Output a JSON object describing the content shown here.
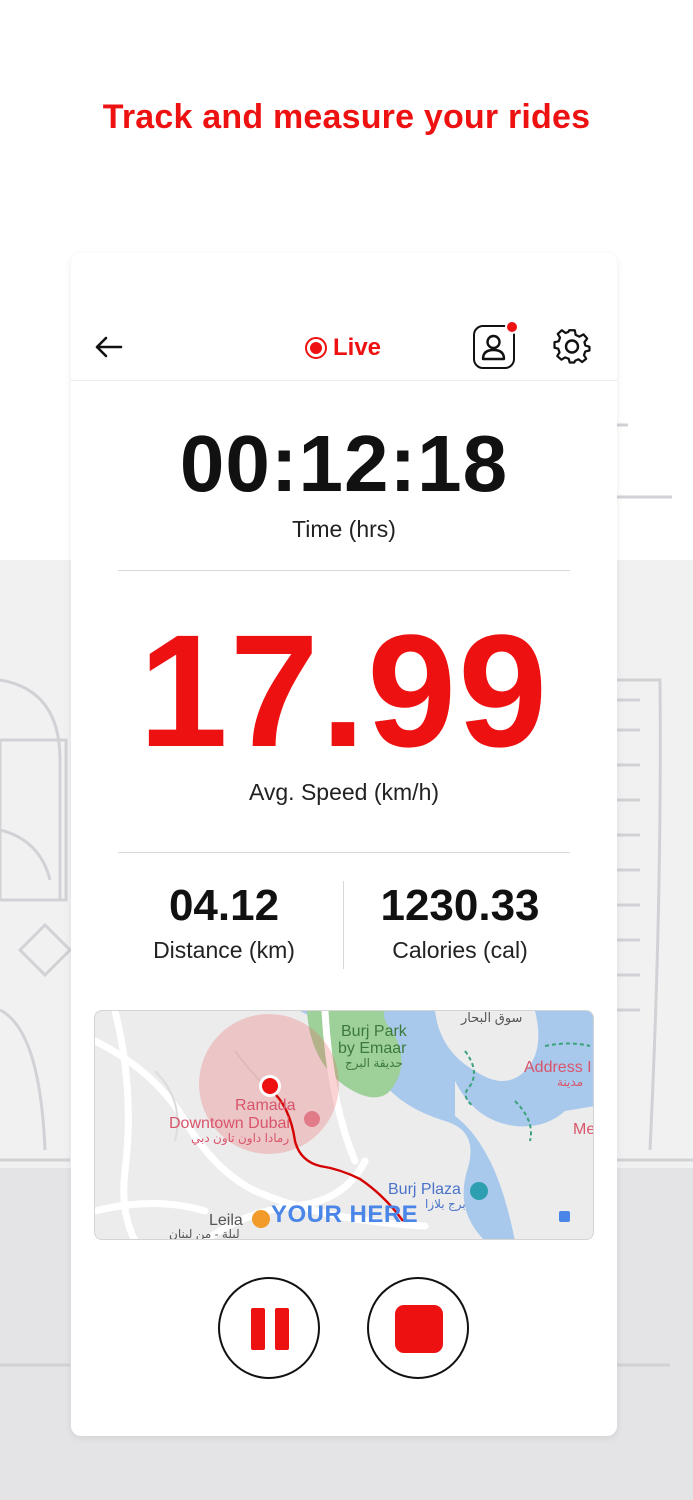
{
  "headline": "Track and measure your rides",
  "colors": {
    "accent": "#ee1111",
    "text": "#111111"
  },
  "header": {
    "live_label": "Live",
    "icons": [
      "back-arrow-icon",
      "live-indicator-icon",
      "profile-icon",
      "gear-icon"
    ]
  },
  "stats": {
    "time": {
      "value": "00:12:18",
      "label": "Time (hrs)"
    },
    "avg_speed": {
      "value": "17.99",
      "label": "Avg. Speed (km/h)"
    },
    "distance": {
      "value": "04.12",
      "label": "Distance (km)"
    },
    "calories": {
      "value": "1230.33",
      "label": "Calories (cal)"
    }
  },
  "map": {
    "labels": {
      "burj_park_1": "Burj Park",
      "burj_park_2": "by Emaar",
      "burj_park_ar": "حديقة البرج",
      "souq": "سوق البحار",
      "address": "Address I",
      "address_ar": "مدينة",
      "ramada_1": "Ramada",
      "ramada_2": "Downtown Dubai",
      "ramada_ar": "رمادا داون تاون دبي",
      "me": "Me",
      "burj_plaza": "Burj Plaza",
      "burj_plaza_ar": "برج بلازا",
      "leila": "Leila",
      "leila_ar": "ليلة - من لبنان",
      "your_here": "YOUR HERE"
    }
  },
  "controls": {
    "pause": "pause",
    "stop": "stop"
  }
}
